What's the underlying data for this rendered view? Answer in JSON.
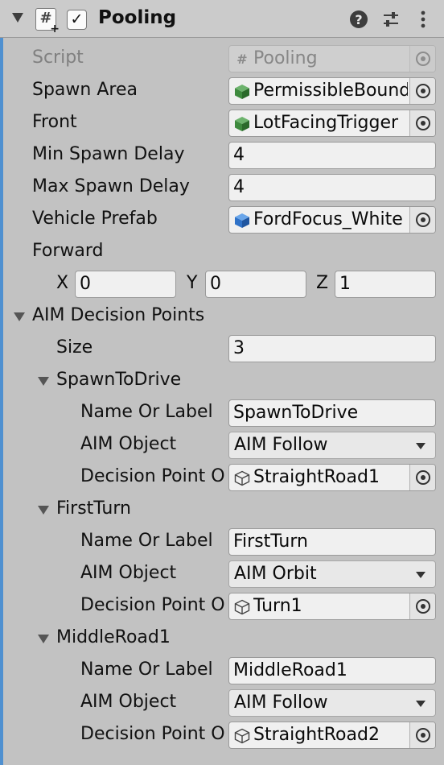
{
  "component": {
    "title": "Pooling",
    "enabled": true,
    "icons": [
      "script-icon",
      "help-icon",
      "preset-icon",
      "kebab-menu-icon"
    ]
  },
  "fields": {
    "script": {
      "label": "Script",
      "value": "Pooling"
    },
    "spawn_area": {
      "label": "Spawn Area",
      "value": "PermissibleBounds"
    },
    "front": {
      "label": "Front",
      "value": "LotFacingTrigger"
    },
    "min_spawn_delay": {
      "label": "Min Spawn Delay",
      "value": "4"
    },
    "max_spawn_delay": {
      "label": "Max Spawn Delay",
      "value": "4"
    },
    "vehicle_prefab": {
      "label": "Vehicle Prefab",
      "value": "FordFocus_White"
    },
    "forward": {
      "label": "Forward",
      "x_label": "X",
      "x": "0",
      "y_label": "Y",
      "y": "0",
      "z_label": "Z",
      "z": "1"
    }
  },
  "aim": {
    "label": "AIM Decision Points",
    "size_label": "Size",
    "size": "3",
    "elements": [
      {
        "title": "SpawnToDrive",
        "name_label": "Name Or Label",
        "name": "SpawnToDrive",
        "object_label": "AIM Object",
        "object": "AIM Follow",
        "point_label": "Decision Point O",
        "point": "StraightRoad1"
      },
      {
        "title": "FirstTurn",
        "name_label": "Name Or Label",
        "name": "FirstTurn",
        "object_label": "AIM Object",
        "object": "AIM Orbit",
        "point_label": "Decision Point O",
        "point": "Turn1"
      },
      {
        "title": "MiddleRoad1",
        "name_label": "Name Or Label",
        "name": "MiddleRoad1",
        "object_label": "AIM Object",
        "object": "AIM Follow",
        "point_label": "Decision Point O",
        "point": "StraightRoad2"
      }
    ]
  },
  "colors": {
    "panel_bg": "#c2c2c2",
    "header_bg": "#cbcbcb",
    "accent_edge": "#4f90d0",
    "gameobject_icon": "#3e8a3e",
    "prefab_icon": "#2f72c8"
  }
}
